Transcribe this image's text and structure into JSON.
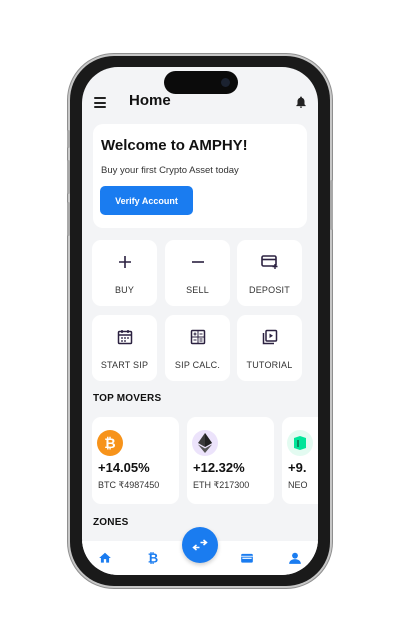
{
  "app": {
    "title": "Home"
  },
  "welcome": {
    "heading": "Welcome to AMPHY!",
    "subtext": "Buy your first Crypto Asset today",
    "verify_label": "Verify Account"
  },
  "actions": [
    {
      "label": "BUY",
      "icon": "plus-icon"
    },
    {
      "label": "SELL",
      "icon": "minus-icon"
    },
    {
      "label": "DEPOSIT",
      "icon": "card-add-icon"
    },
    {
      "label": "START SIP",
      "icon": "calendar-icon"
    },
    {
      "label": "SIP CALC.",
      "icon": "calculator-icon"
    },
    {
      "label": "TUTORIAL",
      "icon": "video-library-icon"
    }
  ],
  "top_movers": {
    "title": "TOP MOVERS",
    "items": [
      {
        "change": "+14.05%",
        "ticker": "BTC",
        "price": "₹4987450",
        "icon": "bitcoin-icon"
      },
      {
        "change": "+12.32%",
        "ticker": "ETH",
        "price": "₹217300",
        "icon": "ethereum-icon"
      },
      {
        "change": "+9.",
        "ticker": "NEO",
        "price": "",
        "icon": "neo-icon"
      }
    ]
  },
  "zones": {
    "title": "ZONES"
  },
  "colors": {
    "accent": "#1a7cf0",
    "icon_dark": "#2b2140",
    "bitcoin": "#f7931a",
    "neo": "#00e599"
  },
  "nav": [
    "home-icon",
    "bitcoin-nav-icon",
    "swap-icon",
    "wallet-icon",
    "profile-icon"
  ]
}
